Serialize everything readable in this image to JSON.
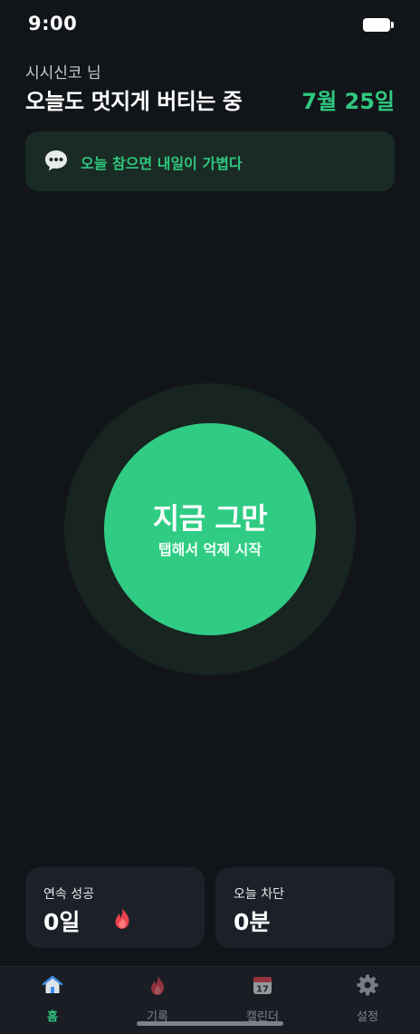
{
  "status": {
    "time": "9:00"
  },
  "header": {
    "user_name": "시시신코 님",
    "title": "오늘도 멋지게 버티는 중",
    "date": "7월 25일"
  },
  "quote": {
    "icon": "chat-bubble-icon",
    "text": "오늘 참으면 내일이 가볍다"
  },
  "main_button": {
    "title": "지금 그만",
    "subtitle": "탭해서 억제 시작"
  },
  "stats": [
    {
      "label": "연속 성공",
      "value": "0일",
      "icon": "flame-icon"
    },
    {
      "label": "오늘 차단",
      "value": "0분"
    }
  ],
  "tabs": [
    {
      "label": "홈",
      "icon": "home-icon",
      "active": true
    },
    {
      "label": "기록",
      "icon": "flame-icon",
      "active": false
    },
    {
      "label": "캘린더",
      "icon": "calendar-icon",
      "calendar_day": "17",
      "active": false
    },
    {
      "label": "설정",
      "icon": "gear-icon",
      "active": false
    }
  ],
  "colors": {
    "accent": "#30c880",
    "background": "#111519",
    "card": "#1c2129"
  }
}
